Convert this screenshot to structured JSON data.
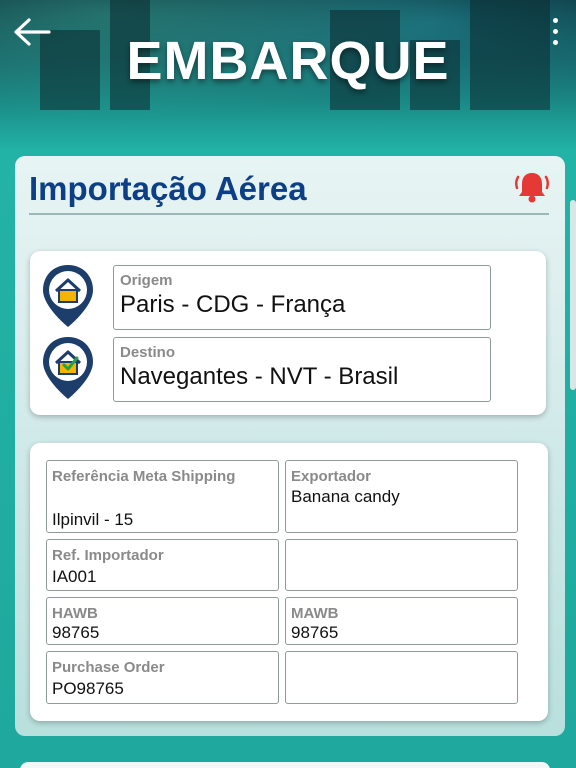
{
  "header": {
    "title": "EMBARQUE"
  },
  "section": {
    "title": "Importação Aérea"
  },
  "route": {
    "origin_label": "Origem",
    "origin_value": "Paris - CDG - França",
    "destination_label": "Destino",
    "destination_value": "Navegantes - NVT - Brasil"
  },
  "details": {
    "ref_meta_label": "Referência Meta Shipping",
    "ref_meta_value": "Ilpinvil - 15",
    "exporter_label": "Exportador",
    "exporter_value": "Banana candy",
    "ref_importer_label": "Ref. Importador",
    "ref_importer_value": "IA001",
    "hawb_label": "HAWB",
    "hawb_value": "98765",
    "mawb_label": "MAWB",
    "mawb_value": "98765",
    "po_label": "Purchase Order",
    "po_value": "PO98765"
  },
  "icons": {
    "back": "arrow-left-icon",
    "menu": "more-vertical-icon",
    "bell": "bell-alert-icon",
    "origin_pin": "home-location-icon",
    "destination_pin": "home-check-location-icon"
  },
  "colors": {
    "title_blue": "#0d3f86",
    "teal": "#22b2a5",
    "pin_navy": "#1d3e6b",
    "home_yellow": "#f4b400",
    "bell_red": "#e53935"
  }
}
